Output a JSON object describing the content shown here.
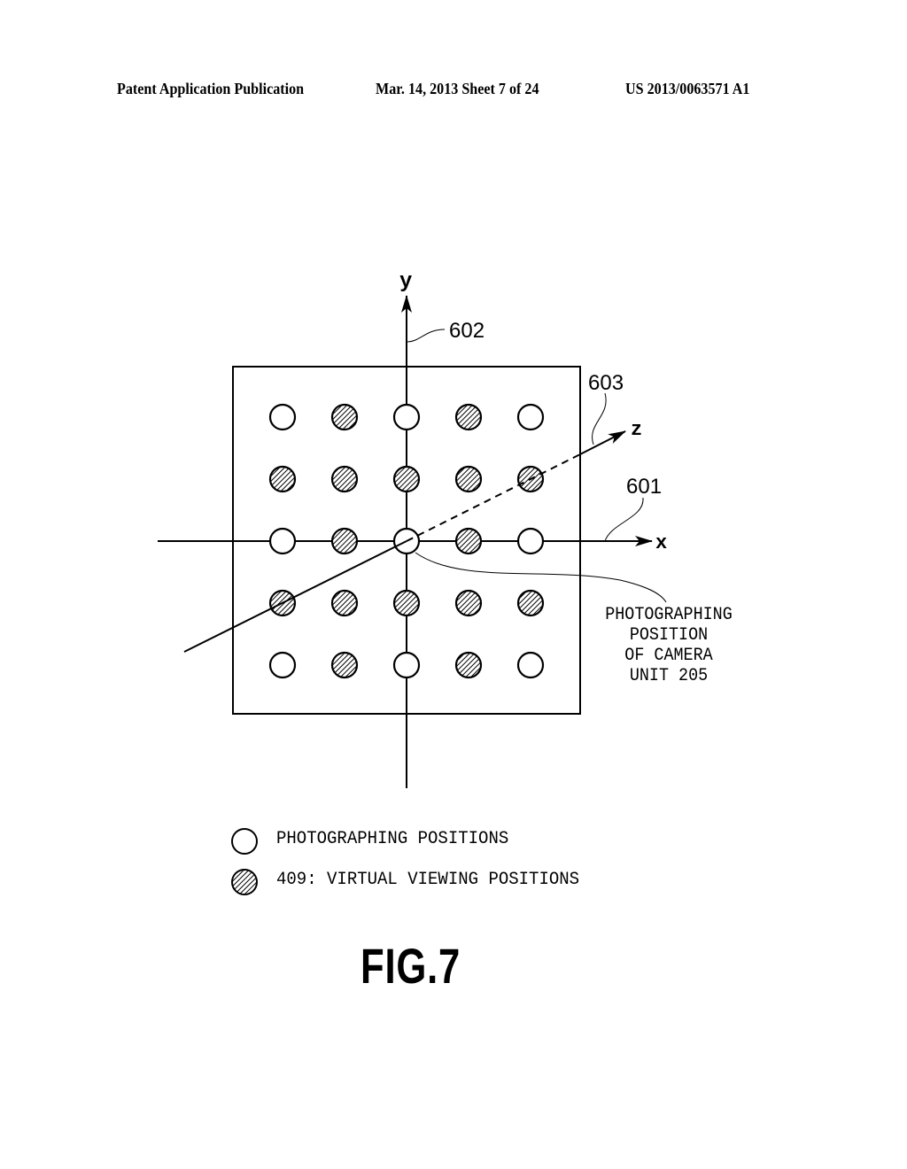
{
  "header": {
    "left": "Patent Application Publication",
    "middle": "Mar. 14, 2013  Sheet 7 of 24",
    "right": "US 2013/0063571 A1"
  },
  "figure": {
    "axes": {
      "x": {
        "label": "x",
        "ref": "601"
      },
      "y": {
        "label": "y",
        "ref": "602"
      },
      "z": {
        "label": "z",
        "ref": "603"
      }
    },
    "grid": {
      "rows": 5,
      "cols": 5,
      "cells": [
        [
          "photographing",
          "virtual",
          "photographing",
          "virtual",
          "photographing"
        ],
        [
          "virtual",
          "virtual",
          "virtual",
          "virtual",
          "virtual"
        ],
        [
          "photographing",
          "virtual",
          "photographing",
          "virtual",
          "photographing"
        ],
        [
          "virtual",
          "virtual",
          "virtual",
          "virtual",
          "virtual"
        ],
        [
          "photographing",
          "virtual",
          "photographing",
          "virtual",
          "photographing"
        ]
      ]
    },
    "callout": {
      "lines": [
        "PHOTOGRAPHING",
        "POSITION",
        "OF CAMERA",
        "UNIT 205"
      ]
    },
    "legend": [
      {
        "symbol": "open-circle",
        "label": "PHOTOGRAPHING POSITIONS"
      },
      {
        "symbol": "hatched-circle",
        "label": "409: VIRTUAL VIEWING POSITIONS"
      }
    ],
    "caption": "FIG.7"
  }
}
